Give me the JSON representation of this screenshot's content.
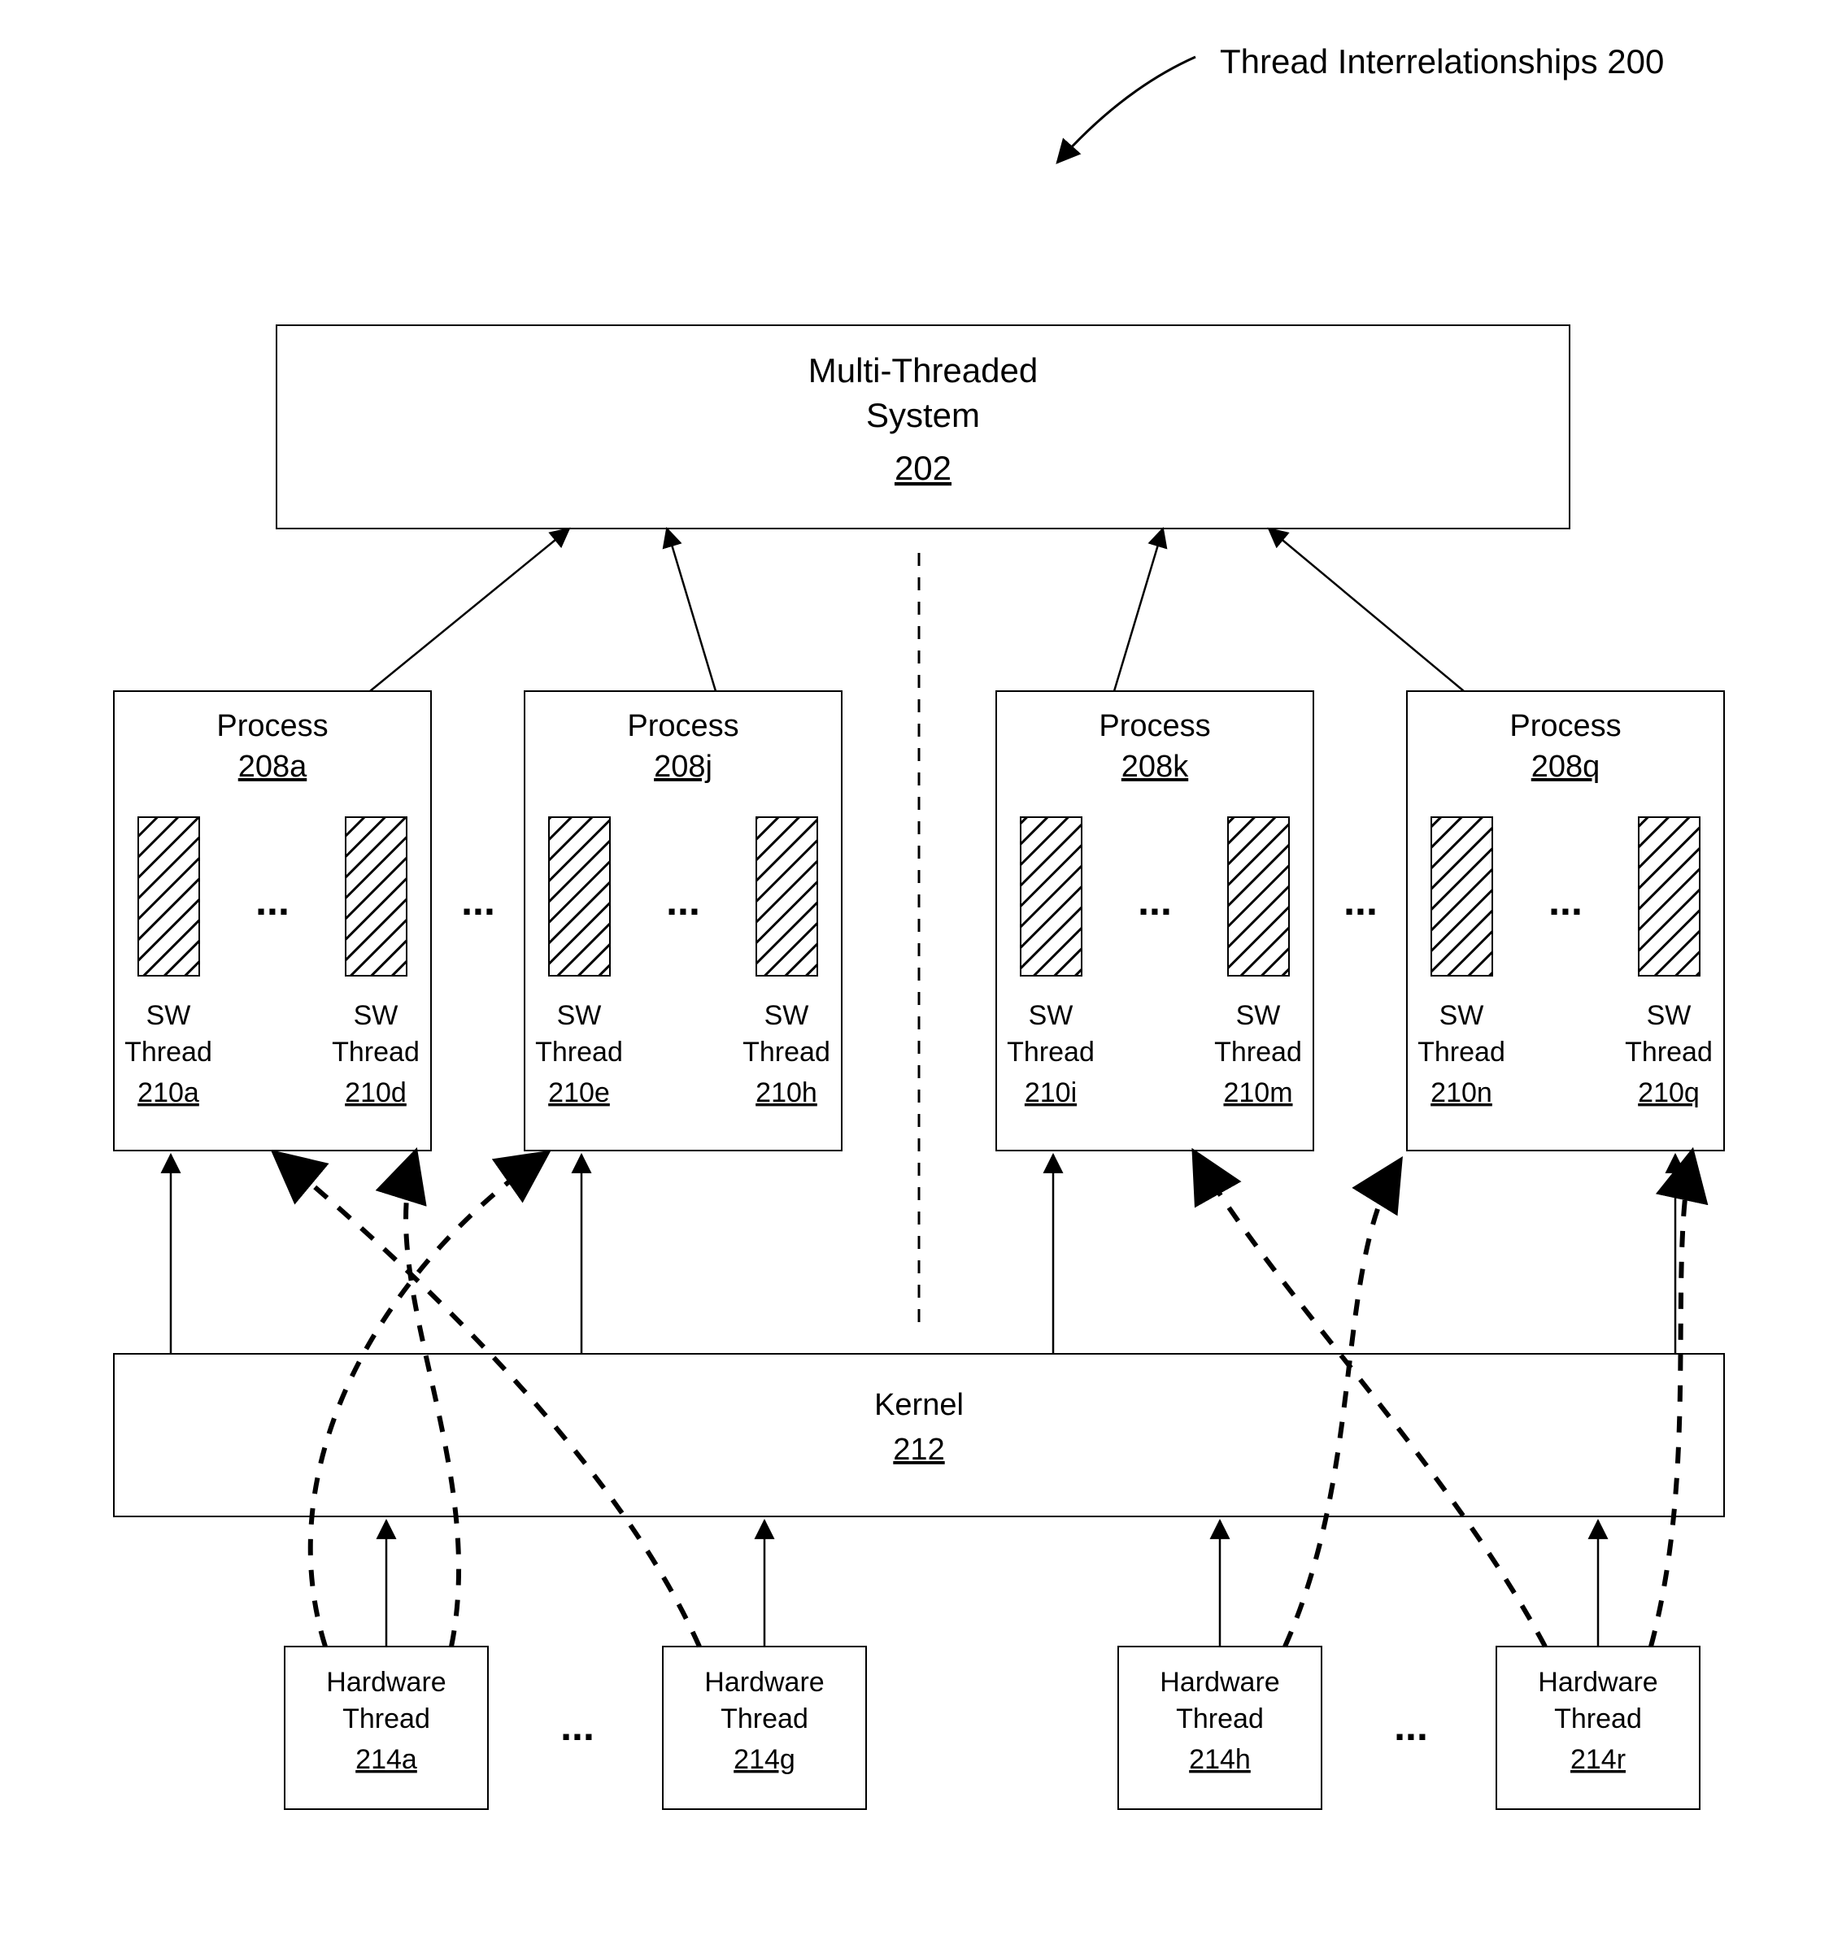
{
  "caption": "Thread Interrelationships 200",
  "top": {
    "line1": "Multi-Threaded",
    "line2": "System",
    "ref": "202"
  },
  "processes": [
    {
      "label": "Process",
      "ref": "208a",
      "threads": [
        {
          "l1": "SW",
          "l2": "Thread",
          "ref": "210a"
        },
        {
          "l1": "SW",
          "l2": "Thread",
          "ref": "210d"
        }
      ]
    },
    {
      "label": "Process",
      "ref": "208j",
      "threads": [
        {
          "l1": "SW",
          "l2": "Thread",
          "ref": "210e"
        },
        {
          "l1": "SW",
          "l2": "Thread",
          "ref": "210h"
        }
      ]
    },
    {
      "label": "Process",
      "ref": "208k",
      "threads": [
        {
          "l1": "SW",
          "l2": "Thread",
          "ref": "210i"
        },
        {
          "l1": "SW",
          "l2": "Thread",
          "ref": "210m"
        }
      ]
    },
    {
      "label": "Process",
      "ref": "208q",
      "threads": [
        {
          "l1": "SW",
          "l2": "Thread",
          "ref": "210n"
        },
        {
          "l1": "SW",
          "l2": "Thread",
          "ref": "210q"
        }
      ]
    }
  ],
  "kernel": {
    "label": "Kernel",
    "ref": "212"
  },
  "hw": [
    {
      "l1": "Hardware",
      "l2": "Thread",
      "ref": "214a"
    },
    {
      "l1": "Hardware",
      "l2": "Thread",
      "ref": "214g"
    },
    {
      "l1": "Hardware",
      "l2": "Thread",
      "ref": "214h"
    },
    {
      "l1": "Hardware",
      "l2": "Thread",
      "ref": "214r"
    }
  ],
  "ellipsis": "..."
}
